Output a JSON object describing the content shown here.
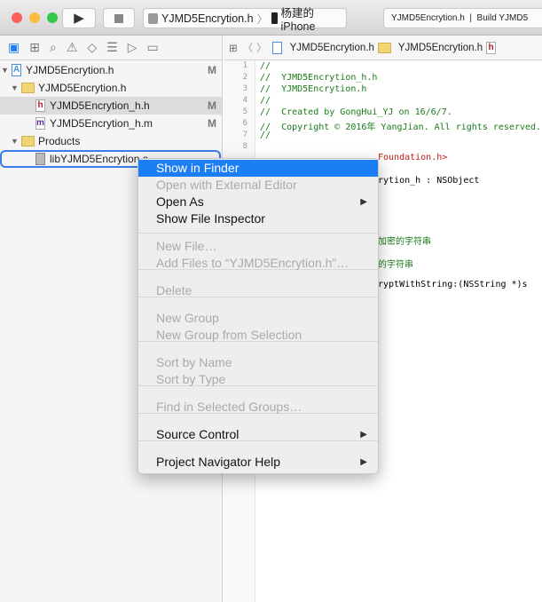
{
  "toolbar": {
    "scheme": "YJMD5Encrytion.h",
    "device": "杨建的 iPhone",
    "status": "YJMD5Encrytion.h  |  Build YJMD5"
  },
  "navigator": {
    "rows": [
      {
        "label": "YJMD5Encrytion.h",
        "badge": "M"
      },
      {
        "label": "YJMD5Encrytion.h"
      },
      {
        "label": "YJMD5Encrytion_h.h",
        "badge": "M"
      },
      {
        "label": "YJMD5Encrytion_h.m",
        "badge": "M"
      },
      {
        "label": "Products"
      },
      {
        "label": "libYJMD5Encrytion.a"
      }
    ]
  },
  "jumpbar": {
    "items": [
      "YJMD5Encrytion.h",
      "YJMD5Encrytion.h"
    ]
  },
  "editor": {
    "lines": [
      "//",
      "//  YJMD5Encrytion_h.h",
      "//  YJMD5Encrytion.h",
      "//",
      "//  Created by GongHui_YJ on 16/6/7.",
      "//  Copyright © 2016年 YangJian. All rights reserved.",
      "//",
      ""
    ],
    "visible_fragments": [
      "Foundation.h>",
      "rytion_h : NSObject",
      "加密的字符串",
      "的字符串",
      "ryptWithString:(NSString *)s"
    ]
  },
  "menu": {
    "items": [
      {
        "label": "Show in Finder",
        "state": "highlighted"
      },
      {
        "label": "Open with External Editor",
        "state": "disabled"
      },
      {
        "label": "Open As",
        "submenu": true
      },
      {
        "label": "Show File Inspector"
      },
      {
        "label": "New File…",
        "state": "disabled"
      },
      {
        "label": "Add Files to “YJMD5Encrytion.h”…",
        "state": "disabled"
      },
      {
        "label": "Delete",
        "state": "disabled"
      },
      {
        "label": "New Group",
        "state": "disabled"
      },
      {
        "label": "New Group from Selection",
        "state": "disabled"
      },
      {
        "label": "Sort by Name",
        "state": "disabled"
      },
      {
        "label": "Sort by Type",
        "state": "disabled"
      },
      {
        "label": "Find in Selected Groups…",
        "state": "disabled"
      },
      {
        "label": "Source Control",
        "submenu": true
      },
      {
        "label": "Project Navigator Help",
        "submenu": true
      }
    ],
    "submenu_arrow": "▶"
  },
  "colors": {
    "highlight": "#1c7ef5",
    "comment": "#1a7a1a",
    "string": "#c41a16"
  }
}
